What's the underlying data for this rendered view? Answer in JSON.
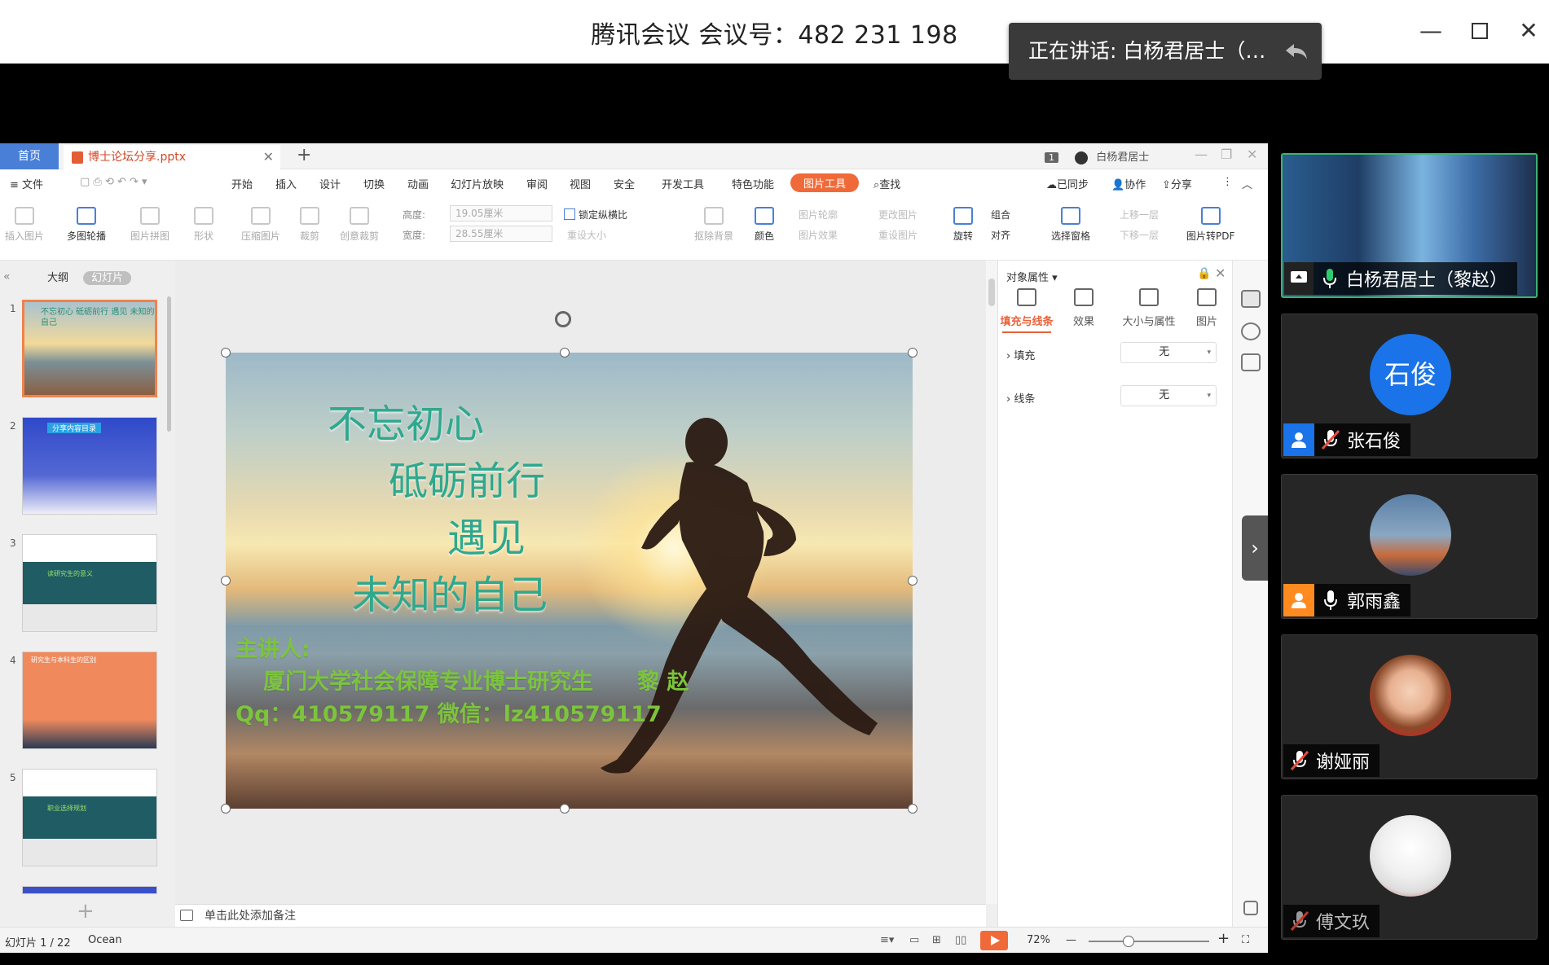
{
  "meeting": {
    "title": "腾讯会议 会议号：482 231 198",
    "speaking": "正在讲话: 白杨君居士（黎赵）",
    "window_controls": [
      "minimize-icon",
      "maximize-icon",
      "close-icon"
    ]
  },
  "wps": {
    "tabs": {
      "home": "首页",
      "file": "博士论坛分享.pptx",
      "add": "+"
    },
    "user": {
      "badge": "1",
      "name": "白杨君居士"
    },
    "menu": {
      "file": "≡ 文件",
      "items": [
        "开始",
        "插入",
        "设计",
        "切换",
        "动画",
        "幻灯片放映",
        "审阅",
        "视图",
        "安全",
        "开发工具",
        "特色功能"
      ],
      "active": "图片工具",
      "search": "查找",
      "synced": "已同步",
      "collab": "协作",
      "share": "分享"
    },
    "ribbon": {
      "insert_pic": "插入图片",
      "multi_carousel": "多图轮播",
      "pic_collage": "图片拼图",
      "shape": "形状",
      "compress": "压缩图片",
      "crop": "裁剪",
      "creative_crop": "创意裁剪",
      "height_label": "高度:",
      "height_value": "19.05厘米",
      "width_label": "宽度:",
      "width_value": "28.55厘米",
      "lock_ratio": "锁定纵横比",
      "reset_size": "重设大小",
      "remove_bg": "抠除背景",
      "color": "颜色",
      "pic_outline": "图片轮廓",
      "pic_effect": "图片效果",
      "change_pic": "更改图片",
      "reset_pic": "重设图片",
      "rotate": "旋转",
      "group": "组合",
      "align": "对齐",
      "select_pane": "选择窗格",
      "bring_forward": "上移一层",
      "send_backward": "下移一层",
      "pic_to_pdf": "图片转PDF"
    },
    "left_panel": {
      "tab_outline": "大纲",
      "tab_slides": "幻灯片",
      "thumb_numbers": [
        "1",
        "2",
        "3",
        "4",
        "5"
      ],
      "thumb_texts": [
        "不忘初心 砥砺前行 遇见 未知的自己",
        "分享内容目录",
        "读研究生的意义",
        "研究生与本科生的区别",
        "职业选择规划"
      ]
    },
    "slide": {
      "line1": "不忘初心",
      "line2": "砥砺前行",
      "line3": "遇见",
      "line4": "未知的自己",
      "presenter_label": "主讲人:",
      "presenter": "厦门大学社会保障专业博士研究生　　黎  赵",
      "contact": "Qq：410579117  微信：lz410579117"
    },
    "notes_placeholder": "单击此处添加备注",
    "properties": {
      "title": "对象属性 ▾",
      "tabs": [
        "填充与线条",
        "效果",
        "大小与属性",
        "图片"
      ],
      "fill_label": "填充",
      "fill_value": "无",
      "line_label": "线条",
      "line_value": "无"
    },
    "status": {
      "slide_count": "幻灯片 1 / 22",
      "theme": "Ocean",
      "zoom": "72%",
      "zoom_fraction": 0.3
    }
  },
  "participants": [
    {
      "name": "白杨君居士（黎赵）",
      "avatar": "",
      "mic": "on",
      "role": "share"
    },
    {
      "name": "张石俊",
      "avatar": "石俊",
      "mic": "muted",
      "role": "host"
    },
    {
      "name": "郭雨鑫",
      "avatar": "",
      "mic": "on",
      "role": "cohost"
    },
    {
      "name": "谢娅丽",
      "avatar": "",
      "mic": "muted",
      "role": ""
    },
    {
      "name": "傅文玖",
      "avatar": "",
      "mic": "muted-dim",
      "role": ""
    }
  ],
  "colors": {
    "accent_orange": "#f06a39",
    "home_tab_blue": "#4a7fd8",
    "speaker_border": "#3cb371",
    "host_blue": "#1a73e8",
    "cohost_orange": "#ff8a1f",
    "mic_green": "#2ecc71"
  }
}
